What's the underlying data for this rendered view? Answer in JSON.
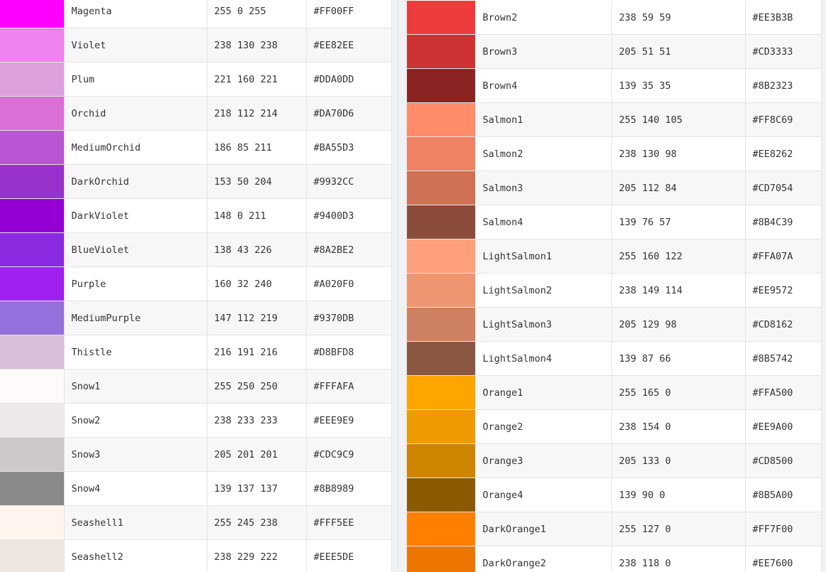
{
  "left_table": {
    "rows": [
      {
        "name": "Magenta",
        "rgb": "255 0 255",
        "hex": "#FF00FF",
        "swatch": "#FF00FF"
      },
      {
        "name": "Violet",
        "rgb": "238 130 238",
        "hex": "#EE82EE",
        "swatch": "#EE82EE"
      },
      {
        "name": "Plum",
        "rgb": "221 160 221",
        "hex": "#DDA0DD",
        "swatch": "#DDA0DD"
      },
      {
        "name": "Orchid",
        "rgb": "218 112 214",
        "hex": "#DA70D6",
        "swatch": "#DA70D6"
      },
      {
        "name": "MediumOrchid",
        "rgb": "186 85 211",
        "hex": "#BA55D3",
        "swatch": "#BA55D3"
      },
      {
        "name": "DarkOrchid",
        "rgb": "153 50 204",
        "hex": "#9932CC",
        "swatch": "#9932CC"
      },
      {
        "name": "DarkViolet",
        "rgb": "148 0 211",
        "hex": "#9400D3",
        "swatch": "#9400D3"
      },
      {
        "name": "BlueViolet",
        "rgb": "138 43 226",
        "hex": "#8A2BE2",
        "swatch": "#8A2BE2"
      },
      {
        "name": "Purple",
        "rgb": "160 32 240",
        "hex": "#A020F0",
        "swatch": "#A020F0"
      },
      {
        "name": "MediumPurple",
        "rgb": "147 112 219",
        "hex": "#9370DB",
        "swatch": "#9370DB"
      },
      {
        "name": "Thistle",
        "rgb": "216 191 216",
        "hex": "#D8BFD8",
        "swatch": "#D8BFD8"
      },
      {
        "name": "Snow1",
        "rgb": "255 250 250",
        "hex": "#FFFAFA",
        "swatch": "#FFFAFA"
      },
      {
        "name": "Snow2",
        "rgb": "238 233 233",
        "hex": "#EEE9E9",
        "swatch": "#EEE9E9"
      },
      {
        "name": "Snow3",
        "rgb": "205 201 201",
        "hex": "#CDC9C9",
        "swatch": "#CDC9C9"
      },
      {
        "name": "Snow4",
        "rgb": "139 137 137",
        "hex": "#8B8989",
        "swatch": "#8B8989"
      },
      {
        "name": "Seashell1",
        "rgb": "255 245 238",
        "hex": "#FFF5EE",
        "swatch": "#FFF5EE"
      },
      {
        "name": "Seashell2",
        "rgb": "238 229 222",
        "hex": "#EEE5DE",
        "swatch": "#EEE5DE"
      }
    ]
  },
  "right_table": {
    "rows": [
      {
        "name": "Brown2",
        "rgb": "238 59 59",
        "hex": "#EE3B3B",
        "swatch": "#EE3B3B"
      },
      {
        "name": "Brown3",
        "rgb": "205 51 51",
        "hex": "#CD3333",
        "swatch": "#CD3333"
      },
      {
        "name": "Brown4",
        "rgb": "139 35 35",
        "hex": "#8B2323",
        "swatch": "#8B2323"
      },
      {
        "name": "Salmon1",
        "rgb": "255 140 105",
        "hex": "#FF8C69",
        "swatch": "#FF8C69"
      },
      {
        "name": "Salmon2",
        "rgb": "238 130 98",
        "hex": "#EE8262",
        "swatch": "#EE8262"
      },
      {
        "name": "Salmon3",
        "rgb": "205 112 84",
        "hex": "#CD7054",
        "swatch": "#CD7054"
      },
      {
        "name": "Salmon4",
        "rgb": "139 76 57",
        "hex": "#8B4C39",
        "swatch": "#8B4C39"
      },
      {
        "name": "LightSalmon1",
        "rgb": "255 160 122",
        "hex": "#FFA07A",
        "swatch": "#FFA07A"
      },
      {
        "name": "LightSalmon2",
        "rgb": "238 149 114",
        "hex": "#EE9572",
        "swatch": "#EE9572"
      },
      {
        "name": "LightSalmon3",
        "rgb": "205 129 98",
        "hex": "#CD8162",
        "swatch": "#CD8162"
      },
      {
        "name": "LightSalmon4",
        "rgb": "139 87 66",
        "hex": "#8B5742",
        "swatch": "#8B5742"
      },
      {
        "name": "Orange1",
        "rgb": "255 165 0",
        "hex": "#FFA500",
        "swatch": "#FFA500"
      },
      {
        "name": "Orange2",
        "rgb": "238 154 0",
        "hex": "#EE9A00",
        "swatch": "#EE9A00"
      },
      {
        "name": "Orange3",
        "rgb": "205 133 0",
        "hex": "#CD8500",
        "swatch": "#CD8500"
      },
      {
        "name": "Orange4",
        "rgb": "139 90 0",
        "hex": "#8B5A00",
        "swatch": "#8B5A00"
      },
      {
        "name": "DarkOrange1",
        "rgb": "255 127 0",
        "hex": "#FF7F00",
        "swatch": "#FF7F00"
      },
      {
        "name": "DarkOrange2",
        "rgb": "238 118 0",
        "hex": "#EE7600",
        "swatch": "#EE7600"
      }
    ]
  }
}
